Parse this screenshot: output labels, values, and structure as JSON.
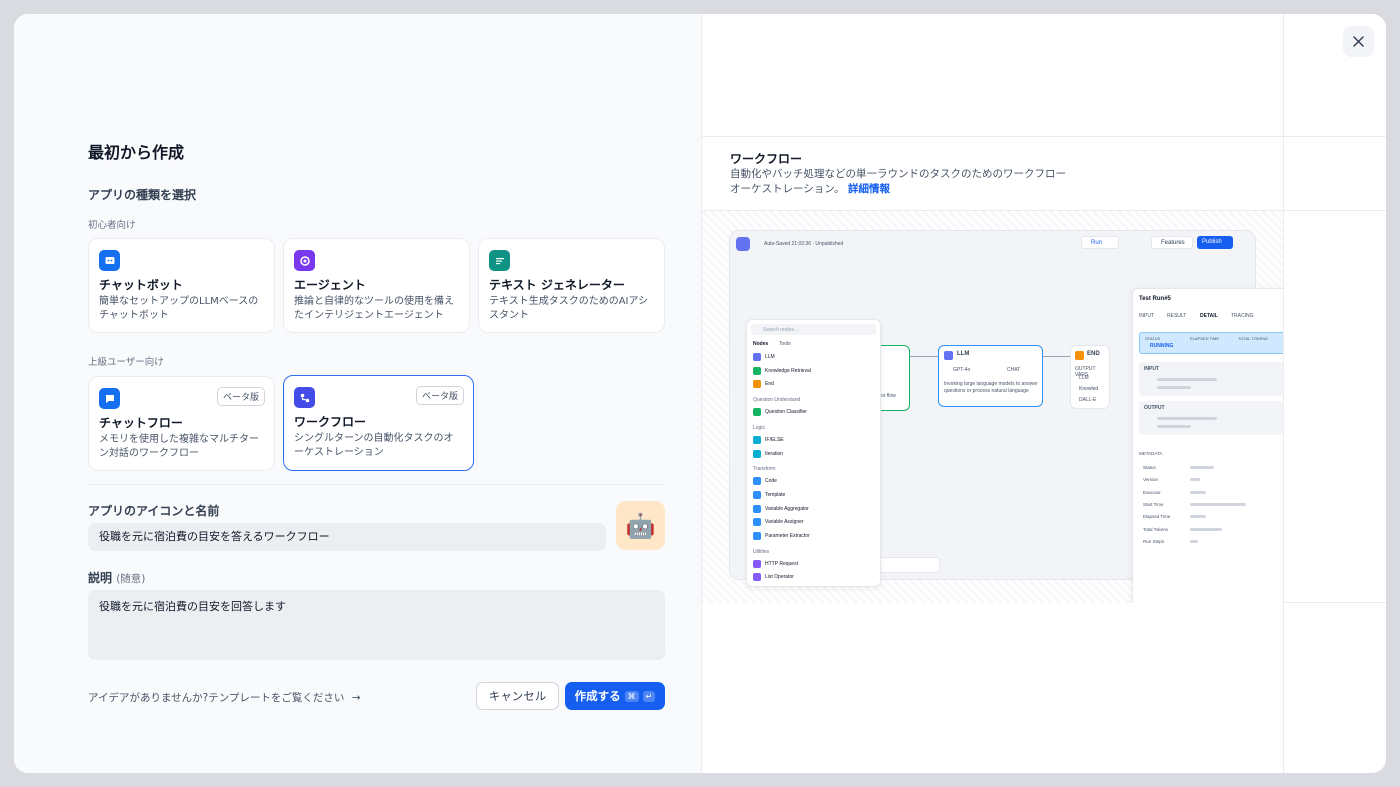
{
  "dialog": {
    "title": "最初から作成",
    "app_type_label": "アプリの種類を選択",
    "beginner_label": "初心者向け",
    "advanced_label": "上級ユーザー向け",
    "beginner_types": [
      {
        "name": "チャットボット",
        "desc": "簡単なセットアップのLLMベースのチャットボット",
        "color": "#1570ef"
      },
      {
        "name": "エージェント",
        "desc": "推論と自律的なツールの使用を備えたインテリジェントエージェント",
        "color": "#7839ee"
      },
      {
        "name": "テキスト ジェネレーター",
        "desc": "テキスト生成タスクのためのAIアシスタント",
        "color": "#0e9384"
      }
    ],
    "advanced_types": [
      {
        "name": "チャットフロー",
        "desc": "メモリを使用した複雑なマルチターン対話のワークフロー",
        "badge": "ベータ版",
        "color": "#1570ef"
      },
      {
        "name": "ワークフロー",
        "desc": "シングルターンの自動化タスクのオーケストレーション",
        "badge": "ベータ版",
        "color": "#444ce7"
      }
    ],
    "icon_name_label": "アプリのアイコンと名前",
    "name_value": "役職を元に宿泊費の目安を答えるワークフロー",
    "app_icon": "🤖",
    "desc_label": "説明",
    "desc_optional": "(随意)",
    "desc_value": "役職を元に宿泊費の目安を回答します",
    "template_link": "アイデアがありませんか?テンプレートをご覧ください",
    "cancel_label": "キャンセル",
    "create_label": "作成する",
    "create_kbd_1": "⌘",
    "create_kbd_2": "↵"
  },
  "preview": {
    "title": "ワークフロー",
    "desc": "自動化やバッチ処理などの単一ラウンドのタスクのためのワークフローオーケストレーション。",
    "more_link": "詳細情報",
    "toolbar": {
      "saved_text": "Auto-Saved 21:02:36 · Unpublished",
      "run": "Run",
      "features": "Features",
      "publish": "Publish"
    },
    "nodes_panel": {
      "search_placeholder": "Search nodes...",
      "tabs": [
        "Nodes",
        "Tools"
      ],
      "items": [
        {
          "label": "LLM",
          "color": "#6172f3"
        },
        {
          "label": "Knowledge Retrieval",
          "color": "#16b364"
        },
        {
          "label": "End",
          "color": "#f79009"
        },
        {
          "label": "Question Understand",
          "header": true
        },
        {
          "label": "Question Classifier",
          "color": "#16b364"
        },
        {
          "label": "Logic",
          "header": true
        },
        {
          "label": "IF/ELSE",
          "color": "#06aed4"
        },
        {
          "label": "Iteration",
          "color": "#06aed4"
        },
        {
          "label": "Transform",
          "header": true
        },
        {
          "label": "Code",
          "color": "#2e90fa"
        },
        {
          "label": "Template",
          "color": "#2e90fa"
        },
        {
          "label": "Variable Aggregator",
          "color": "#2e90fa"
        },
        {
          "label": "Variable Assigner",
          "color": "#2e90fa"
        },
        {
          "label": "Parameter Extractor",
          "color": "#2e90fa"
        },
        {
          "label": "Utilities",
          "header": true
        },
        {
          "label": "HTTP Request",
          "color": "#875bf7"
        },
        {
          "label": "List Operator",
          "color": "#875bf7"
        }
      ]
    },
    "llm_node": {
      "title": "LLM",
      "model": "GPT-4o",
      "mode": "CHAT",
      "desc": "Invoking large language models to answer questions or process natural language"
    },
    "start_node_text": "parameters for flow",
    "end_node": {
      "title": "END",
      "output_label": "OUTPUT VARS",
      "rows": [
        "LLM",
        "Knowled",
        "DALL-E"
      ]
    },
    "test_run": {
      "title": "Test Run#5",
      "tabs": [
        "INPUT",
        "RESULT",
        "DETAIL",
        "TRACING"
      ],
      "status_label": "STATUS",
      "status_value": "RUNNING",
      "elapsed_label": "ELAPSED TIME",
      "tokens_label": "TOTAL TOKENS",
      "input_label": "INPUT",
      "output_label": "OUTPUT",
      "metadata_label": "METADATA",
      "meta_keys": [
        "Status",
        "Version",
        "Executor",
        "Start Time",
        "Elapsed Time",
        "Total Tokens",
        "Run Steps"
      ]
    }
  }
}
